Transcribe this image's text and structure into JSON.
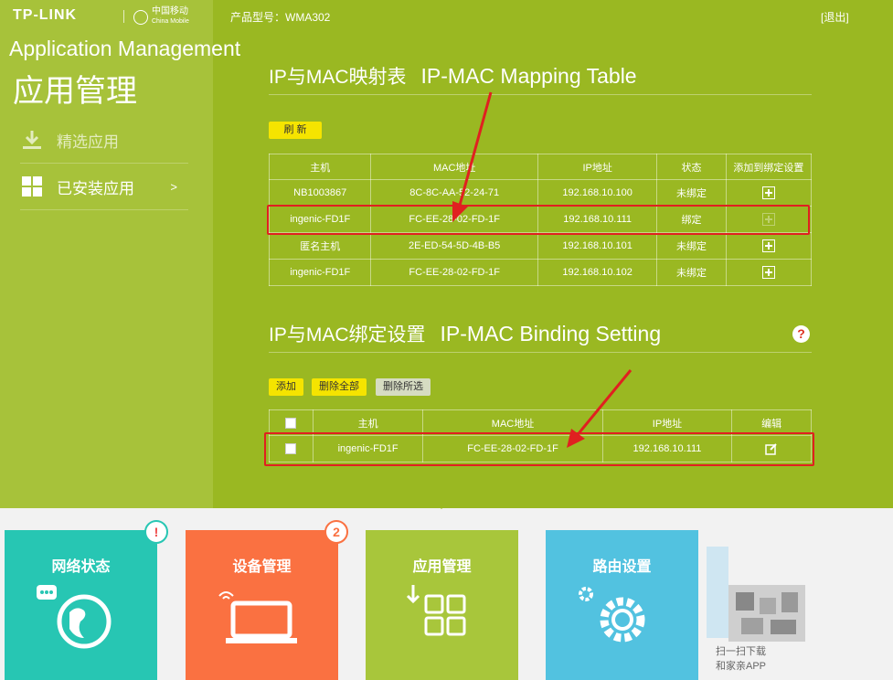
{
  "header": {
    "brand": "TP-LINK",
    "partner_cn": "中国移动",
    "partner_en": "China Mobile",
    "product_model": "产品型号：WMA302",
    "logout": "[退出]"
  },
  "annotation_title": "Application Management",
  "page_title": "应用管理",
  "sidebar": {
    "items": [
      {
        "label": "精选应用",
        "icon": "download-icon"
      },
      {
        "label": "已安装应用",
        "icon": "grid-icon",
        "chevron": ">"
      }
    ]
  },
  "mapping": {
    "title": "IP与MAC映射表",
    "title_en": "IP-MAC Mapping Table",
    "refresh": "刷 新",
    "columns": [
      "主机",
      "MAC地址",
      "IP地址",
      "状态",
      "添加到绑定设置"
    ],
    "rows": [
      {
        "host": "NB1003867",
        "mac": "8C-8C-AA-52-24-71",
        "ip": "192.168.10.100",
        "status": "未绑定"
      },
      {
        "host": "ingenic-FD1F",
        "mac": "FC-EE-28-02-FD-1F",
        "ip": "192.168.10.111",
        "status": "绑定"
      },
      {
        "host": "匿名主机",
        "mac": "2E-ED-54-5D-4B-B5",
        "ip": "192.168.10.101",
        "status": "未绑定"
      },
      {
        "host": "ingenic-FD1F",
        "mac": "FC-EE-28-02-FD-1F",
        "ip": "192.168.10.102",
        "status": "未绑定"
      }
    ]
  },
  "binding": {
    "title": "IP与MAC绑定设置",
    "title_en": "IP-MAC Binding Setting",
    "help": "?",
    "add": "添加",
    "delete_all": "删除全部",
    "delete_selected": "删除所选",
    "columns": [
      "主机",
      "MAC地址",
      "IP地址",
      "编辑"
    ],
    "rows": [
      {
        "host": "ingenic-FD1F",
        "mac": "FC-EE-28-02-FD-1F",
        "ip": "192.168.10.111"
      }
    ]
  },
  "tiles": [
    {
      "label": "网络状态",
      "color": "#27c6b3",
      "badge": "!"
    },
    {
      "label": "设备管理",
      "color": "#fa7141",
      "badge": "2"
    },
    {
      "label": "应用管理",
      "color": "#a8c63b"
    },
    {
      "label": "路由设置",
      "color": "#52c2e0"
    }
  ],
  "qr": {
    "line1": "扫一扫下载",
    "line2": "和家亲APP"
  },
  "colors": {
    "highlight": "#e02020",
    "button_yellow": "#f5e400"
  }
}
